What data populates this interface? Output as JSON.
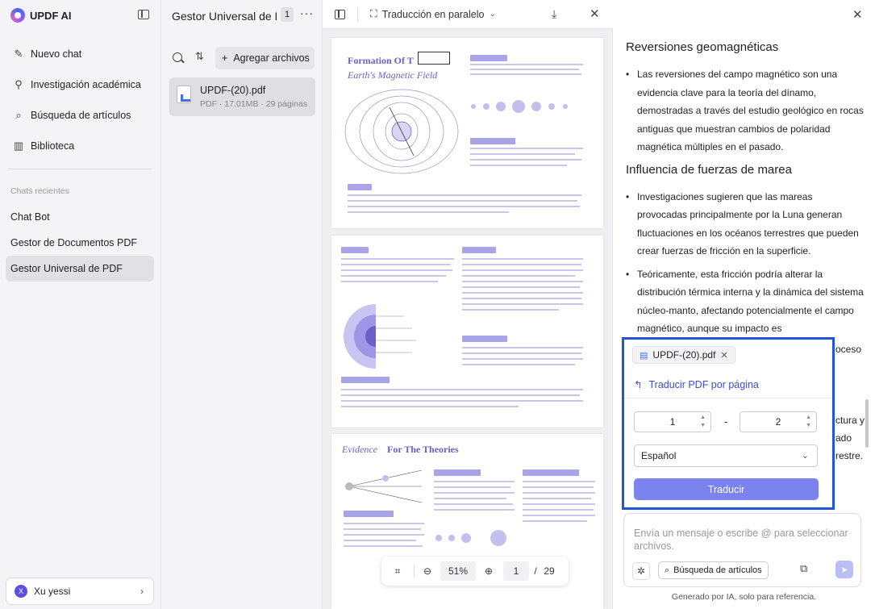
{
  "sidebar": {
    "brand": "UPDF AI",
    "nav": [
      {
        "label": "Nuevo chat",
        "icon": "edit-icon"
      },
      {
        "label": "Investigación académica",
        "icon": "telescope-icon"
      },
      {
        "label": "Búsqueda de artículos",
        "icon": "doc-search-icon"
      },
      {
        "label": "Biblioteca",
        "icon": "library-icon"
      }
    ],
    "recent_title": "Chats recientes",
    "recent": [
      "Chat Bot",
      "Gestor de Documentos PDF",
      "Gestor Universal de PDF"
    ],
    "user": {
      "initial": "X",
      "name": "Xu yessi"
    }
  },
  "files": {
    "title": "Gestor Universal de PDF",
    "count": "1",
    "add_label": "Agregar archivos",
    "file": {
      "name": "UPDF-(20).pdf",
      "meta": "PDF · 17.01MB · 29 páginas"
    }
  },
  "viewer": {
    "mode_label": "Traducción en paralelo",
    "page1_title": "Formation Of T",
    "page1_sub": "Earth's Magnetic Field",
    "page3_title_a": "Evidence",
    "page3_title_b": "For The Theories",
    "zoom": "51%",
    "page": "1",
    "page_sep": "/",
    "total_pages": "29"
  },
  "chat": {
    "h1": "Reversiones geomagnéticas",
    "b1": "Las reversiones del campo magnético son una evidencia clave para la teoría del dínamo, demostradas a través del estudio geológico en rocas antiguas que muestran cambios de polaridad magnética múltiples en el pasado.",
    "h2": "Influencia de fuerzas de marea",
    "b2": "Investigaciones sugieren que las mareas provocadas principalmente por la Luna generan fluctuaciones en los océanos terrestres que pueden crear fuerzas de fricción en la superficie.",
    "b3": "Teóricamente, esta fricción podría alterar la distribución térmica interna y la dinámica del sistema núcleo-manto, afectando potencialmente el campo magnético, aunque su impacto es",
    "peek1": "oceso",
    "peek2": "ctura y",
    "peek3": "ado",
    "peek4": "restre.",
    "popup": {
      "chip": "UPDF-(20).pdf",
      "back": "Traducir PDF por página",
      "from": "1",
      "dash": "-",
      "to": "2",
      "language": "Español",
      "button": "Traducir"
    },
    "input_placeholder": "Envía un mensaje o escribe @ para seleccionar archivos.",
    "chip_label": "Búsqueda de artículos",
    "footer": "Generado por IA, solo para referencia."
  }
}
